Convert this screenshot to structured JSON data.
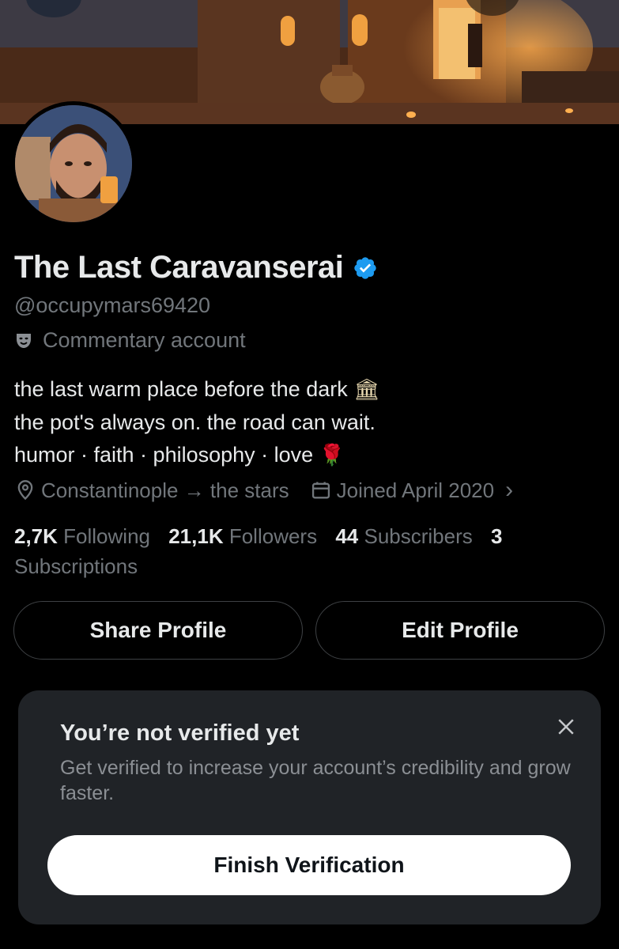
{
  "profile": {
    "display_name": "The Last Caravanserai",
    "handle": "@occupymars69420",
    "account_label": "Commentary account",
    "bio_lines": [
      "the last warm place before the dark",
      "the pot's always on. the road can wait.",
      "humor · faith · philosophy · love"
    ],
    "bio_emoji_1": "🏛",
    "bio_emoji_2": "🌹",
    "location": "Constantinople → the stars",
    "joined": "Joined April 2020",
    "joined_chevron": "›"
  },
  "stats": {
    "following_count": "2,7K",
    "following_label": "Following",
    "followers_count": "21,1K",
    "followers_label": "Followers",
    "subscribers_count": "44",
    "subscribers_label": "Subscribers",
    "subscriptions_count": "3",
    "subscriptions_label": "Subscriptions"
  },
  "actions": {
    "share_label": "Share Profile",
    "edit_label": "Edit Profile"
  },
  "verify_card": {
    "title": "You’re not verified yet",
    "description": "Get verified to increase your account’s credibility and grow faster.",
    "button_label": "Finish Verification"
  },
  "colors": {
    "background": "#000000",
    "primary_text": "#e7e9ea",
    "secondary_text": "#71767b",
    "verified_blue": "#1d9bf0",
    "card_bg": "#202327"
  },
  "icons": {
    "verified": "verified-badge-icon",
    "mask": "theater-mask-icon",
    "location": "location-pin-icon",
    "calendar": "calendar-icon",
    "close": "close-icon"
  }
}
